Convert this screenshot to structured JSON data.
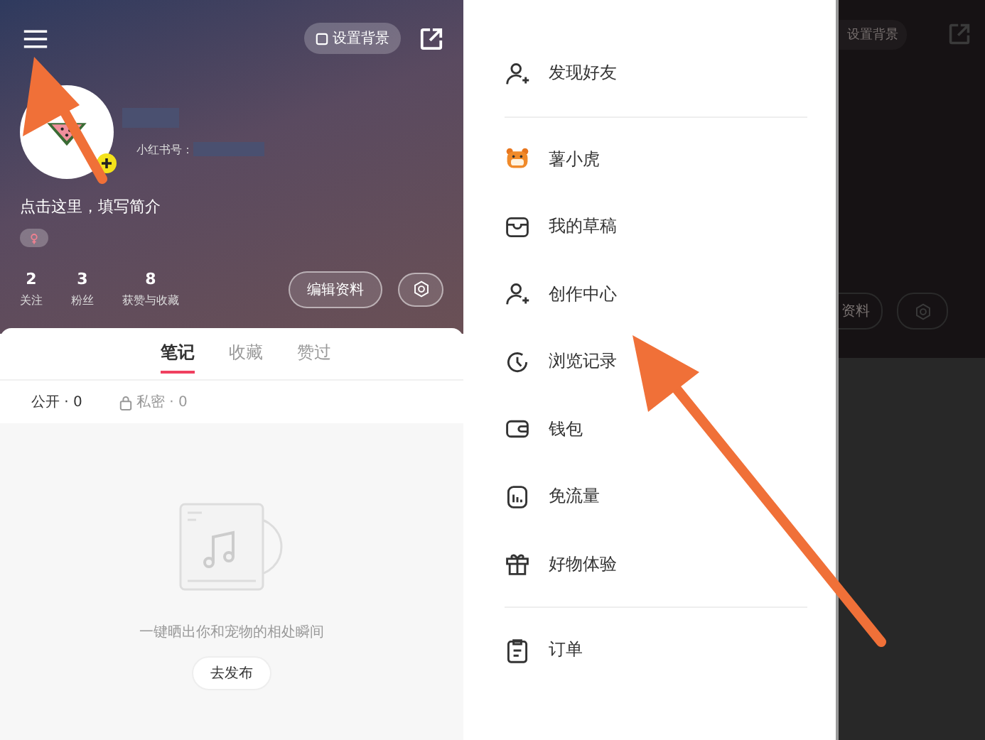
{
  "profile": {
    "background_button": "设置背景",
    "id_label": "小红书号：",
    "bio": "点击这里，填写简介",
    "stats": [
      {
        "value": "2",
        "label": "关注"
      },
      {
        "value": "3",
        "label": "粉丝"
      },
      {
        "value": "8",
        "label": "获赞与收藏"
      }
    ],
    "edit_button": "编辑资料"
  },
  "tabs": [
    {
      "label": "笔记",
      "selected": true
    },
    {
      "label": "收藏",
      "selected": false
    },
    {
      "label": "赞过",
      "selected": false
    }
  ],
  "filters": [
    {
      "label": "公开 · 0",
      "locked": false
    },
    {
      "label": "私密 · 0",
      "locked": true
    }
  ],
  "empty_state": {
    "message": "一键晒出你和宠物的相处瞬间",
    "button": "去发布"
  },
  "drawer": {
    "sections": [
      [
        {
          "kind": "user-add",
          "label": "发现好友"
        }
      ],
      [
        {
          "kind": "tiger",
          "label": "薯小虎"
        },
        {
          "kind": "inbox",
          "label": "我的草稿"
        },
        {
          "kind": "user-add",
          "label": "创作中心"
        },
        {
          "kind": "clock",
          "label": "浏览记录"
        },
        {
          "kind": "wallet",
          "label": "钱包"
        },
        {
          "kind": "data",
          "label": "免流量"
        },
        {
          "kind": "gift",
          "label": "好物体验"
        }
      ],
      [
        {
          "kind": "clipboard",
          "label": "订单"
        }
      ]
    ]
  },
  "dimmed_profile": {
    "background_button": "设置背景",
    "edit_button": "资料"
  }
}
